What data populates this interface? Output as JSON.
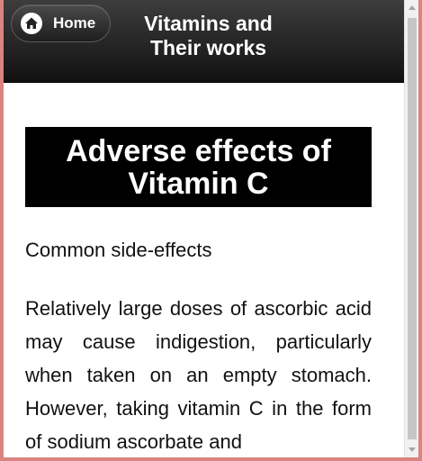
{
  "header": {
    "home_label": "Home",
    "title_line1": "Vitamins and",
    "title_line2": "Their works"
  },
  "article": {
    "banner_line1": "Adverse effects of",
    "banner_line2": "Vitamin C",
    "subheading": "Common side-effects",
    "paragraph": "Relatively large doses of ascorbic acid may cause indigestion, particularly when taken on an empty stomach. However, taking vitamin C in the form of sodium ascorbate and"
  },
  "icons": {
    "home": "home-icon",
    "scroll_up": "scroll-up-arrow-icon",
    "scroll_down": "scroll-down-arrow-icon"
  }
}
